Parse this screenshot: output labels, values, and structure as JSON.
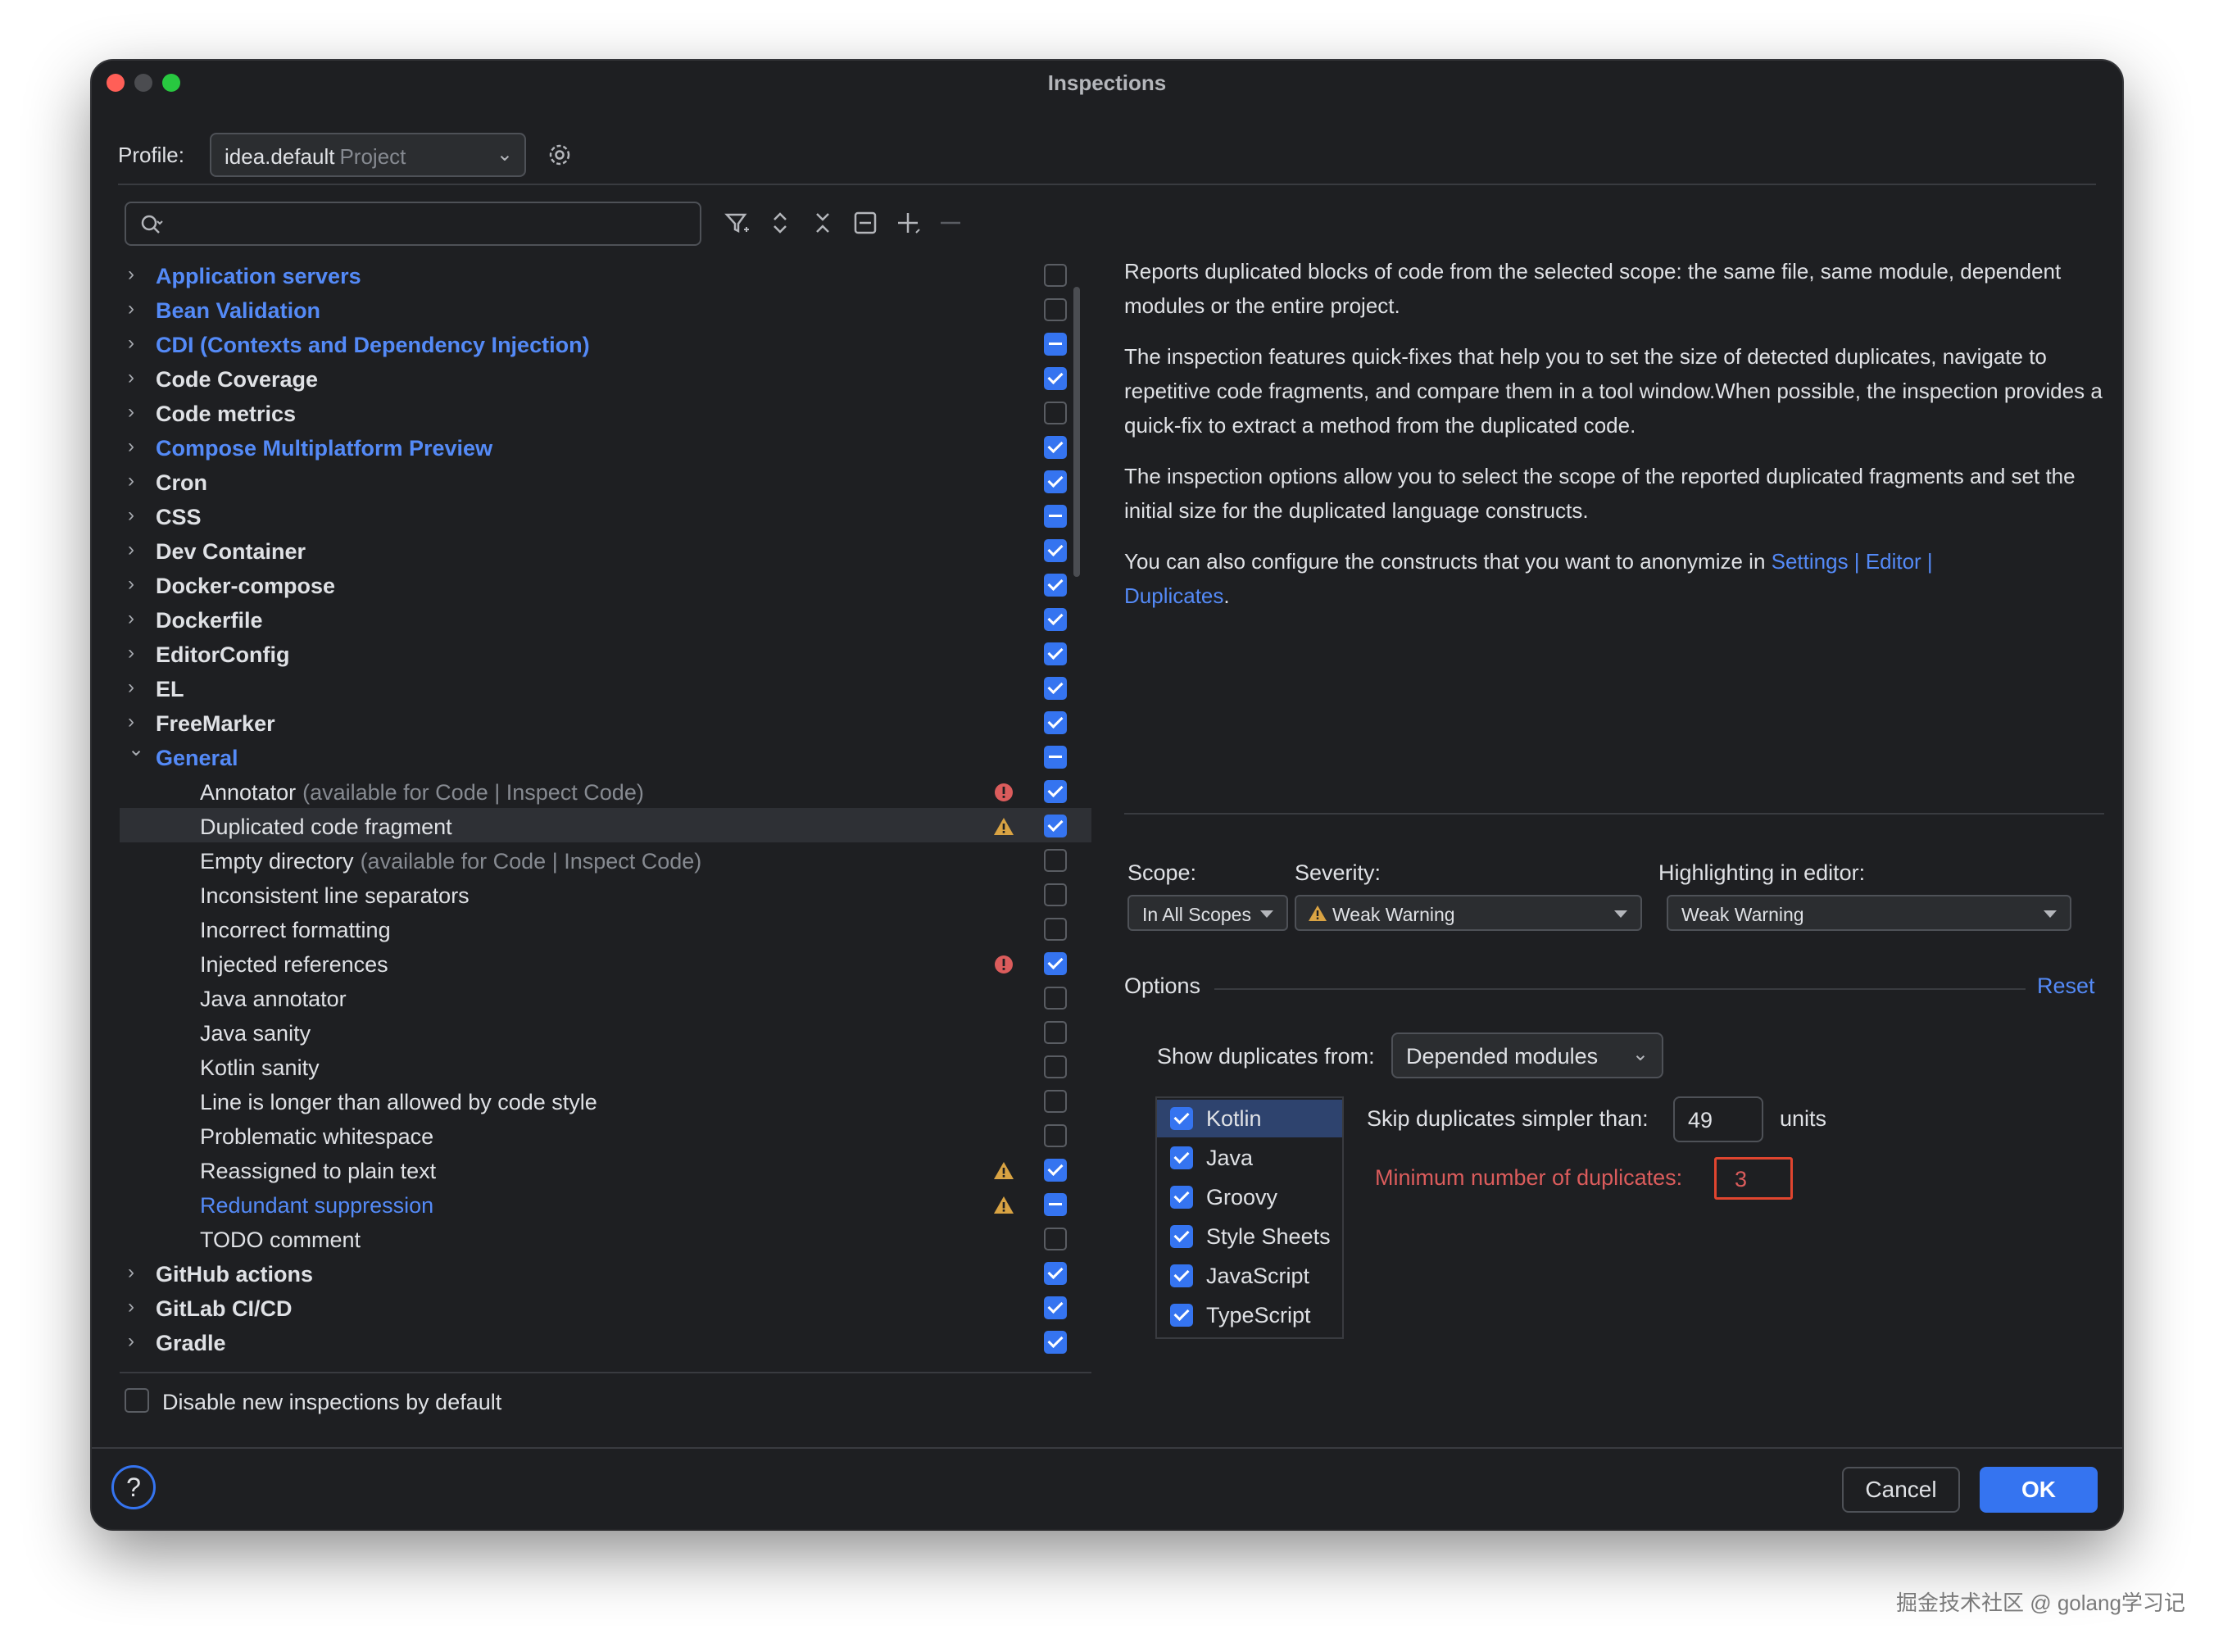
{
  "window": {
    "title": "Inspections"
  },
  "profile": {
    "label": "Profile:",
    "name": "idea.default",
    "scope": "Project"
  },
  "search": {
    "placeholder": ""
  },
  "tree": [
    {
      "kind": "group",
      "label": "Application servers",
      "blue": true,
      "expanded": false,
      "check": "off"
    },
    {
      "kind": "group",
      "label": "Bean Validation",
      "blue": true,
      "expanded": false,
      "check": "off"
    },
    {
      "kind": "group",
      "label": "CDI (Contexts and Dependency Injection)",
      "blue": true,
      "expanded": false,
      "check": "partial"
    },
    {
      "kind": "group",
      "label": "Code Coverage",
      "blue": false,
      "expanded": false,
      "check": "on"
    },
    {
      "kind": "group",
      "label": "Code metrics",
      "blue": false,
      "expanded": false,
      "check": "off"
    },
    {
      "kind": "group",
      "label": "Compose Multiplatform Preview",
      "blue": true,
      "expanded": false,
      "check": "on"
    },
    {
      "kind": "group",
      "label": "Cron",
      "blue": false,
      "expanded": false,
      "check": "on"
    },
    {
      "kind": "group",
      "label": "CSS",
      "blue": false,
      "expanded": false,
      "check": "partial"
    },
    {
      "kind": "group",
      "label": "Dev Container",
      "blue": false,
      "expanded": false,
      "check": "on"
    },
    {
      "kind": "group",
      "label": "Docker-compose",
      "blue": false,
      "expanded": false,
      "check": "on"
    },
    {
      "kind": "group",
      "label": "Dockerfile",
      "blue": false,
      "expanded": false,
      "check": "on"
    },
    {
      "kind": "group",
      "label": "EditorConfig",
      "blue": false,
      "expanded": false,
      "check": "on"
    },
    {
      "kind": "group",
      "label": "EL",
      "blue": false,
      "expanded": false,
      "check": "on"
    },
    {
      "kind": "group",
      "label": "FreeMarker",
      "blue": false,
      "expanded": false,
      "check": "on"
    },
    {
      "kind": "group",
      "label": "General",
      "blue": true,
      "expanded": true,
      "check": "partial"
    },
    {
      "kind": "item",
      "label": "Annotator",
      "note": "(available for Code | Inspect Code)",
      "severity": "error",
      "check": "on"
    },
    {
      "kind": "item",
      "label": "Duplicated code fragment",
      "severity": "weak",
      "check": "on",
      "selected": true
    },
    {
      "kind": "item",
      "label": "Empty directory",
      "note": "(available for Code | Inspect Code)",
      "check": "off"
    },
    {
      "kind": "item",
      "label": "Inconsistent line separators",
      "check": "off"
    },
    {
      "kind": "item",
      "label": "Incorrect formatting",
      "check": "off"
    },
    {
      "kind": "item",
      "label": "Injected references",
      "severity": "error",
      "check": "on"
    },
    {
      "kind": "item",
      "label": "Java annotator",
      "check": "off"
    },
    {
      "kind": "item",
      "label": "Java sanity",
      "check": "off"
    },
    {
      "kind": "item",
      "label": "Kotlin sanity",
      "check": "off"
    },
    {
      "kind": "item",
      "label": "Line is longer than allowed by code style",
      "check": "off"
    },
    {
      "kind": "item",
      "label": "Problematic whitespace",
      "check": "off"
    },
    {
      "kind": "item",
      "label": "Reassigned to plain text",
      "severity": "warning",
      "check": "on"
    },
    {
      "kind": "item",
      "label": "Redundant suppression",
      "link": true,
      "severity": "warning",
      "check": "partial"
    },
    {
      "kind": "item",
      "label": "TODO comment",
      "check": "off"
    },
    {
      "kind": "group",
      "label": "GitHub actions",
      "blue": false,
      "expanded": false,
      "check": "on"
    },
    {
      "kind": "group",
      "label": "GitLab CI/CD",
      "blue": false,
      "expanded": false,
      "check": "on"
    },
    {
      "kind": "group",
      "label": "Gradle",
      "blue": false,
      "expanded": false,
      "check": "on"
    }
  ],
  "disable_new": {
    "label": "Disable new inspections by default",
    "checked": false
  },
  "description": {
    "p1": "Reports duplicated blocks of code from the selected scope: the same file, same module, dependent modules or the entire project.",
    "p2": "The inspection features quick-fixes that help you to set the size of detected duplicates, navigate to repetitive code fragments, and compare them in a tool window.When possible, the inspection provides a quick-fix to extract a method from the duplicated code.",
    "p3": "The inspection options allow you to select the scope of the reported duplicated fragments and set the initial size for the duplicated language constructs.",
    "p4_prefix": "You can also configure the constructs that you want to anonymize in ",
    "p4_link1": "Settings",
    "p4_link2": "Editor",
    "p4_link3": "Duplicates",
    "p4_suffix": "."
  },
  "scope": {
    "label": "Scope:",
    "value": "In All Scopes"
  },
  "severity": {
    "label": "Severity:",
    "value": "Weak Warning"
  },
  "highlighting": {
    "label": "Highlighting in editor:",
    "value": "Weak Warning"
  },
  "options": {
    "label": "Options",
    "reset": "Reset"
  },
  "show_duplicates": {
    "label": "Show duplicates from:",
    "value": "Depended modules"
  },
  "languages": [
    {
      "name": "Kotlin",
      "checked": true,
      "selected": true
    },
    {
      "name": "Java",
      "checked": true
    },
    {
      "name": "Groovy",
      "checked": true
    },
    {
      "name": "Style Sheets",
      "checked": true
    },
    {
      "name": "JavaScript",
      "checked": true
    },
    {
      "name": "TypeScript",
      "checked": true
    }
  ],
  "skip": {
    "label": "Skip duplicates simpler than:",
    "value": "49",
    "units": "units"
  },
  "min_dups": {
    "label": "Minimum number of duplicates:",
    "value": "3"
  },
  "buttons": {
    "cancel": "Cancel",
    "ok": "OK",
    "help": "?"
  },
  "watermark": "掘金技术社区 @ golang学习记",
  "colors": {
    "accent": "#3574f0",
    "link": "#548af7",
    "error": "#db5c5c",
    "warning": "#d9a343",
    "background": "#1e1f22"
  }
}
